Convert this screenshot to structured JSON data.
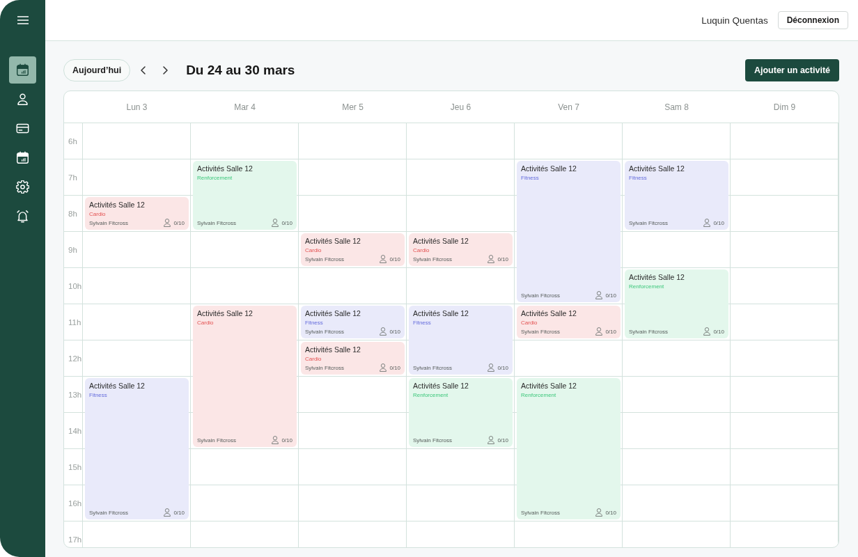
{
  "sidebar": {
    "items": [
      {
        "selected": true
      },
      {
        "selected": false
      },
      {
        "selected": false
      },
      {
        "selected": false
      },
      {
        "selected": false
      },
      {
        "selected": false
      }
    ]
  },
  "header": {
    "user_name": "Luquin Quentas",
    "logout_button": "Déconnexion"
  },
  "toolbar": {
    "today_button": "Aujourd’hui",
    "title": "Du 24 au 30 mars",
    "add_button": "Ajouter un activité"
  },
  "calendar": {
    "hours": [
      "6h",
      "7h",
      "8h",
      "9h",
      "10h",
      "11h",
      "12h",
      "13h",
      "14h",
      "15h",
      "16h",
      "17h"
    ],
    "days": [
      {
        "label": "Lun 3",
        "slots": [
          {
            "kind": "free"
          },
          {
            "kind": "free"
          },
          {
            "kind": "event",
            "title": "Activités Salle 12",
            "category": "Cardio",
            "color": "#fbe6e6",
            "coach": "Sylvain Fitcross",
            "capacity": "0/10"
          },
          {
            "kind": "free"
          },
          {
            "kind": "free"
          },
          {
            "kind": "free"
          },
          {
            "kind": "free"
          },
          {
            "kind": "event",
            "title": "Activités Salle 12",
            "category": "Fitness",
            "color": "#e9eafa",
            "coach": "Sylvain Fitcross",
            "capacity": "0/10"
          },
          {
            "kind": "continued"
          },
          {
            "kind": "continued"
          },
          {
            "kind": "continued"
          }
        ]
      },
      {
        "label": "Mar 4",
        "slots": [
          {
            "kind": "free"
          },
          {
            "kind": "event",
            "title": "Activités Salle 12",
            "category": "Renforcement",
            "color": "#e3f7ec",
            "coach": "Sylvain Fitcross",
            "capacity": "0/10"
          },
          {
            "kind": "continued"
          },
          {
            "kind": "free"
          },
          {
            "kind": "free"
          },
          {
            "kind": "event",
            "title": "Activités Salle 12",
            "category": "Cardio",
            "color": "#fbe6e6",
            "coach": "Sylvain Fitcross",
            "capacity": "0/10"
          },
          {
            "kind": "continued"
          },
          {
            "kind": "continued"
          },
          {
            "kind": "continued"
          }
        ]
      },
      {
        "label": "Mer 5",
        "slots": [
          {
            "kind": "free"
          },
          {
            "kind": "free"
          },
          {
            "kind": "free"
          },
          {
            "kind": "event",
            "title": "Activités Salle 12",
            "category": "Cardio",
            "color": "#fbe6e6",
            "coach": "Sylvain Fitcross",
            "capacity": "0/10"
          },
          {
            "kind": "free"
          },
          {
            "kind": "event",
            "title": "Activités Salle 12",
            "category": "Fitness",
            "color": "#e9eafa",
            "coach": "Sylvain Fitcross",
            "capacity": "0/10"
          },
          {
            "kind": "event",
            "title": "Activités Salle 12",
            "category": "Cardio",
            "color": "#fbe6e6",
            "coach": "Sylvain Fitcross",
            "capacity": "0/10"
          }
        ]
      },
      {
        "label": "Jeu 6",
        "slots": [
          {
            "kind": "free"
          },
          {
            "kind": "free"
          },
          {
            "kind": "free"
          },
          {
            "kind": "event",
            "title": "Activités Salle 12",
            "category": "Cardio",
            "color": "#fbe6e6",
            "coach": "Sylvain Fitcross",
            "capacity": "0/10"
          },
          {
            "kind": "free"
          },
          {
            "kind": "event",
            "title": "Activités Salle 12",
            "category": "Fitness",
            "color": "#e9eafa",
            "coach": "Sylvain Fitcross",
            "capacity": "0/10"
          },
          {
            "kind": "continued"
          },
          {
            "kind": "event",
            "title": "Activités Salle 12",
            "category": "Renforcement",
            "color": "#e3f7ec",
            "coach": "Sylvain Fitcross",
            "capacity": "0/10"
          },
          {
            "kind": "continued"
          }
        ]
      },
      {
        "label": "Ven 7",
        "slots": [
          {
            "kind": "free"
          },
          {
            "kind": "event",
            "title": "Activités Salle 12",
            "category": "Fitness",
            "color": "#e9eafa",
            "coach": "Sylvain Fitcross",
            "capacity": "0/10"
          },
          {
            "kind": "continued"
          },
          {
            "kind": "continued"
          },
          {
            "kind": "continued"
          },
          {
            "kind": "event",
            "title": "Activités Salle 12",
            "category": "Cardio",
            "color": "#fbe6e6",
            "coach": "Sylvain Fitcross",
            "capacity": "0/10"
          },
          {
            "kind": "free"
          },
          {
            "kind": "event",
            "title": "Activités Salle 12",
            "category": "Renforcement",
            "color": "#e3f7ec",
            "coach": "Sylvain Fitcross",
            "capacity": "0/10"
          },
          {
            "kind": "continued"
          },
          {
            "kind": "continued"
          },
          {
            "kind": "continued"
          }
        ]
      },
      {
        "label": "Sam 8",
        "slots": [
          {
            "kind": "free"
          },
          {
            "kind": "event",
            "title": "Activités Salle 12",
            "category": "Fitness",
            "color": "#e9eafa",
            "coach": "Sylvain Fitcross",
            "capacity": "0/10"
          },
          {
            "kind": "continued"
          },
          {
            "kind": "free"
          },
          {
            "kind": "event",
            "title": "Activités Salle 12",
            "category": "Renforcement",
            "color": "#e3f7ec",
            "coach": "Sylvain Fitcross",
            "capacity": "0/10"
          },
          {
            "kind": "continued"
          }
        ]
      },
      {
        "label": "Dim 9"
      }
    ]
  }
}
